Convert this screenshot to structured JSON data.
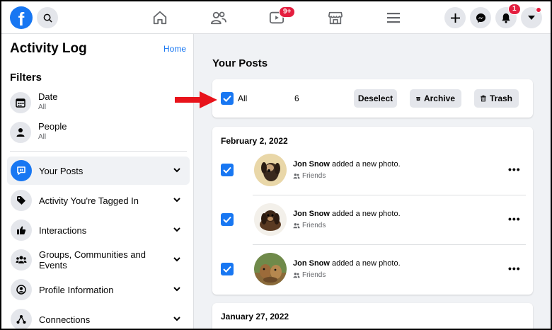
{
  "topbar": {
    "logo_letter": "f",
    "watch_badge": "9+",
    "notifications_badge": "1",
    "icons": [
      "search-icon",
      "home-icon",
      "friends-icon",
      "watch-icon",
      "marketplace-icon",
      "menu-icon",
      "plus-icon",
      "messenger-icon",
      "bell-icon",
      "caret-down-icon"
    ]
  },
  "sidebar": {
    "title": "Activity Log",
    "home_link": "Home",
    "filters_title": "Filters",
    "filters": [
      {
        "label": "Date",
        "sub": "All",
        "icon": "calendar-icon"
      },
      {
        "label": "People",
        "sub": "All",
        "icon": "person-icon"
      }
    ],
    "categories": [
      {
        "label": "Your Posts",
        "icon": "post-icon",
        "active": true
      },
      {
        "label": "Activity You're Tagged In",
        "icon": "tag-icon"
      },
      {
        "label": "Interactions",
        "icon": "thumbs-up-icon"
      },
      {
        "label": "Groups, Communities and Events",
        "icon": "groups-icon"
      },
      {
        "label": "Profile Information",
        "icon": "profile-icon"
      },
      {
        "label": "Connections",
        "icon": "connections-icon"
      }
    ]
  },
  "main": {
    "title": "Your Posts",
    "select_bar": {
      "all_label": "All",
      "count": "6",
      "deselect": "Deselect",
      "archive": "Archive",
      "trash": "Trash"
    },
    "groups": [
      {
        "date": "February 2, 2022",
        "posts": [
          {
            "name": "Jon Snow",
            "action": " added a new photo.",
            "audience": "Friends"
          },
          {
            "name": "Jon Snow",
            "action": " added a new photo.",
            "audience": "Friends"
          },
          {
            "name": "Jon Snow",
            "action": " added a new photo.",
            "audience": "Friends"
          }
        ]
      },
      {
        "date": "January 27, 2022",
        "posts": []
      }
    ],
    "more_label": "•••"
  },
  "colors": {
    "brand": "#1877f2",
    "badge": "#e41e3f",
    "arrow": "#e8131b",
    "page_bg": "#f0f2f5"
  }
}
